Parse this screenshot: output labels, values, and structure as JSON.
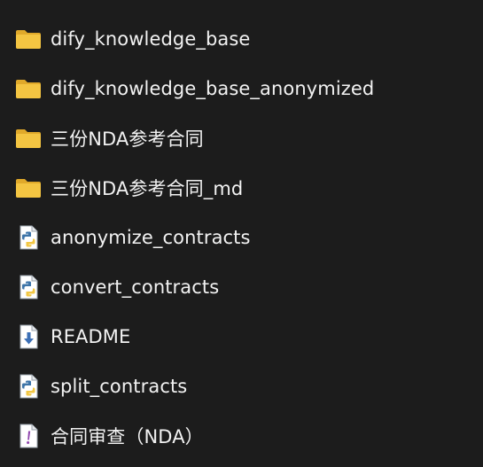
{
  "colors": {
    "background": "#1c1c1c",
    "text": "#f2f2f2",
    "folder": "#f4c542",
    "folder_dark": "#e0a92a",
    "python_blue": "#3d74a8",
    "python_yellow": "#f2c744",
    "download_blue": "#3b6fb6",
    "text_file_purple": "#8e44ad"
  },
  "files": [
    {
      "name": "dify_knowledge_base",
      "icon": "folder-icon"
    },
    {
      "name": "dify_knowledge_base_anonymized",
      "icon": "folder-icon"
    },
    {
      "name": "三份NDA参考合同",
      "icon": "folder-icon"
    },
    {
      "name": "三份NDA参考合同_md",
      "icon": "folder-icon"
    },
    {
      "name": "anonymize_contracts",
      "icon": "python-file-icon"
    },
    {
      "name": "convert_contracts",
      "icon": "python-file-icon"
    },
    {
      "name": "README",
      "icon": "markdown-file-icon"
    },
    {
      "name": "split_contracts",
      "icon": "python-file-icon"
    },
    {
      "name": "合同审查（NDA）",
      "icon": "text-file-icon"
    }
  ]
}
